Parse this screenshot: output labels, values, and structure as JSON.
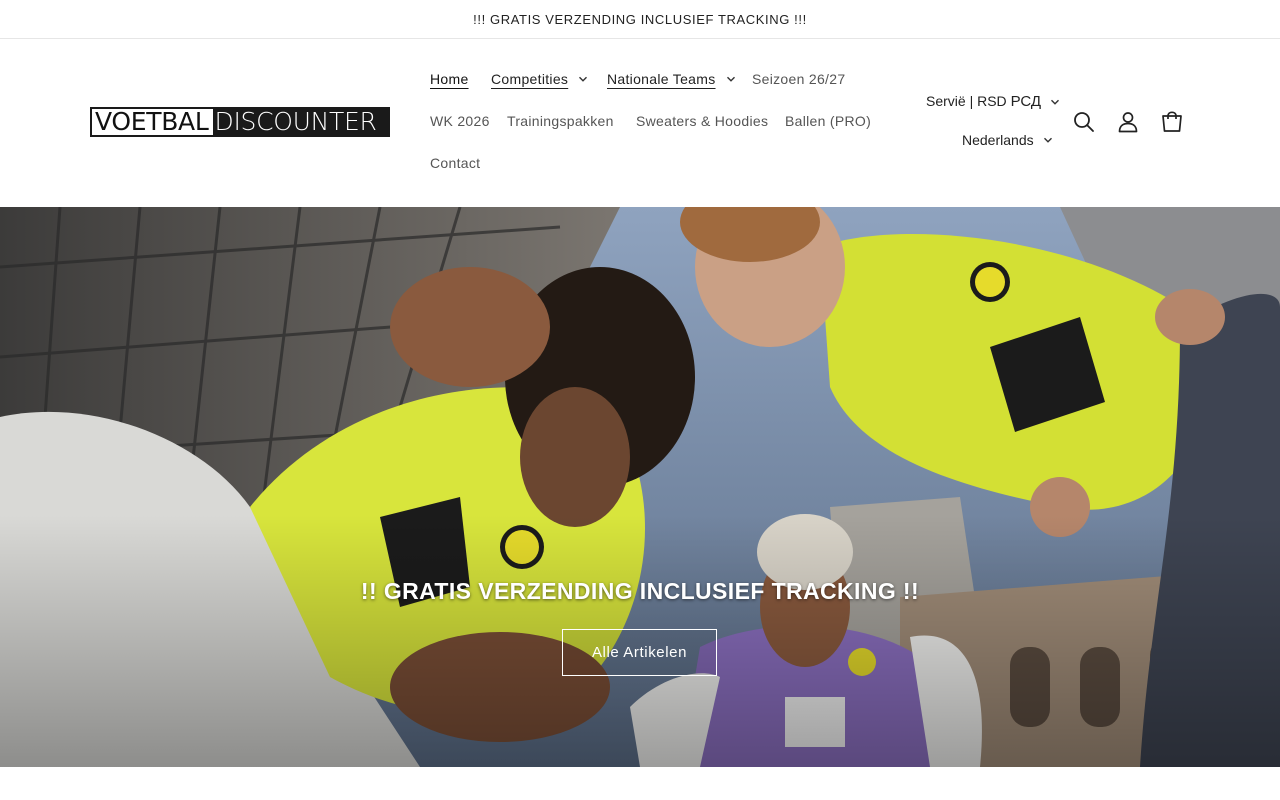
{
  "announcement": {
    "text": "!!! GRATIS VERZENDING INCLUSIEF TRACKING !!!"
  },
  "logo": {
    "part1": "VOETBAL",
    "part2": "DISCOUNTER"
  },
  "nav": {
    "home": "Home",
    "competities": "Competities",
    "nationale_teams": "Nationale Teams",
    "seizoen": "Seizoen 26/27",
    "wk": "WK 2026",
    "trainingspakken": "Trainingspakken",
    "sweaters": "Sweaters & Hoodies",
    "ballen": "Ballen (PRO)",
    "contact": "Contact"
  },
  "localization": {
    "country_currency": "Servië | RSD",
    "currency_symbol": "РСД",
    "language": "Nederlands"
  },
  "icons": {
    "search": "search-icon",
    "account": "account-icon",
    "cart": "cart-icon",
    "chevron": "chevron-down-icon"
  },
  "hero": {
    "heading": "!! GRATIS VERZENDING INCLUSIEF TRACKING !!",
    "button_label": "Alle Artikelen"
  },
  "colors": {
    "jersey_yellow": "#d8e53c",
    "jersey_purple": "#8b6fc0",
    "text": "#121212",
    "muted": "#555555"
  }
}
